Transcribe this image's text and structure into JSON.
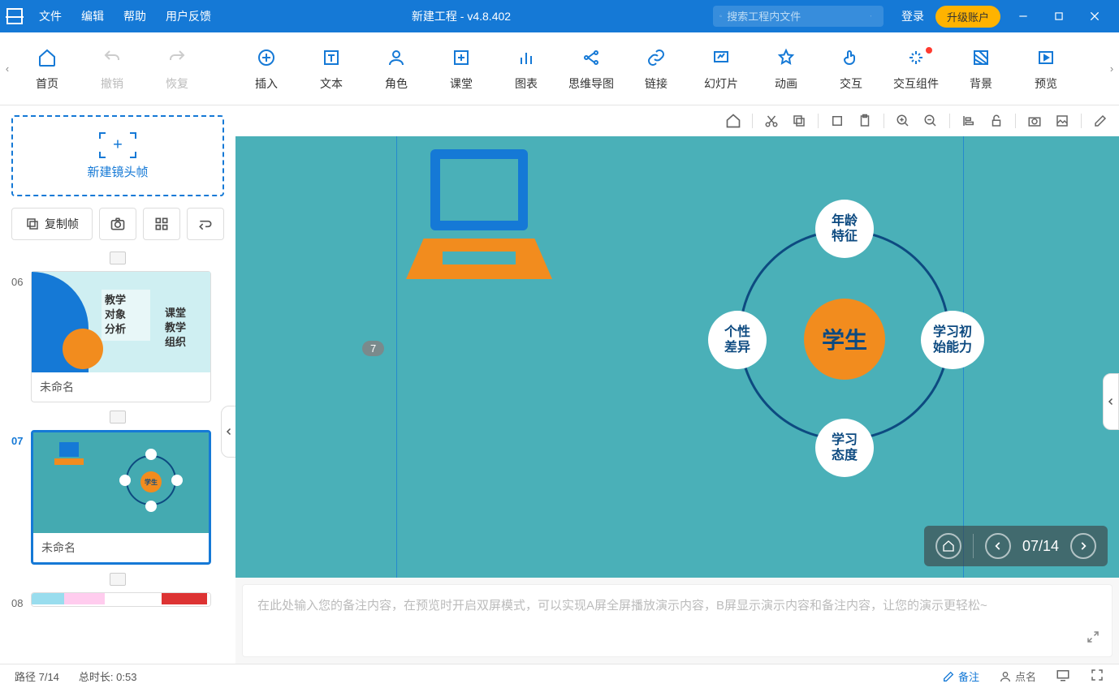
{
  "titlebar": {
    "menus": [
      "文件",
      "编辑",
      "帮助",
      "用户反馈"
    ],
    "title": "新建工程 - v4.8.402",
    "search_placeholder": "搜索工程内文件",
    "login": "登录",
    "upgrade": "升级账户"
  },
  "toolbar": {
    "items": [
      {
        "label": "首页",
        "name": "home"
      },
      {
        "label": "撤销",
        "name": "undo",
        "disabled": true
      },
      {
        "label": "恢复",
        "name": "redo",
        "disabled": true
      },
      {
        "label": "插入",
        "name": "insert"
      },
      {
        "label": "文本",
        "name": "text"
      },
      {
        "label": "角色",
        "name": "role"
      },
      {
        "label": "课堂",
        "name": "classroom"
      },
      {
        "label": "图表",
        "name": "chart"
      },
      {
        "label": "思维导图",
        "name": "mindmap"
      },
      {
        "label": "链接",
        "name": "link"
      },
      {
        "label": "幻灯片",
        "name": "slide"
      },
      {
        "label": "动画",
        "name": "animation"
      },
      {
        "label": "交互",
        "name": "interaction"
      },
      {
        "label": "交互组件",
        "name": "interaction-component",
        "dot": true
      },
      {
        "label": "背景",
        "name": "background"
      },
      {
        "label": "预览",
        "name": "preview"
      }
    ]
  },
  "side": {
    "new_frame": "新建镜头帧",
    "copy_frame": "复制帧",
    "thumbs": [
      {
        "num": "06",
        "label": "未命名",
        "t6_l1": "教学",
        "t6_l2": "对象",
        "t6_l3": "分析",
        "t6_r1": "课堂",
        "t6_r2": "教学",
        "t6_r3": "组织"
      },
      {
        "num": "07",
        "label": "未命名",
        "selected": true,
        "mini_center": "学生"
      },
      {
        "num": "08",
        "label": ""
      }
    ]
  },
  "canvas": {
    "page_badge": "7",
    "center": "学生",
    "nodes": {
      "top": "年龄\n特征",
      "left": "个性\n差异",
      "right": "学习初\n始能力",
      "bottom": "学习\n态度"
    },
    "nav": {
      "page": "07/14"
    }
  },
  "notes": {
    "placeholder": "在此处输入您的备注内容，在预览时开启双屏模式，可以实现A屏全屏播放演示内容，B屏显示演示内容和备注内容，让您的演示更轻松~"
  },
  "status": {
    "path": "路径 7/14",
    "duration": "总时长: 0:53",
    "notes": "备注",
    "roll": "点名"
  }
}
